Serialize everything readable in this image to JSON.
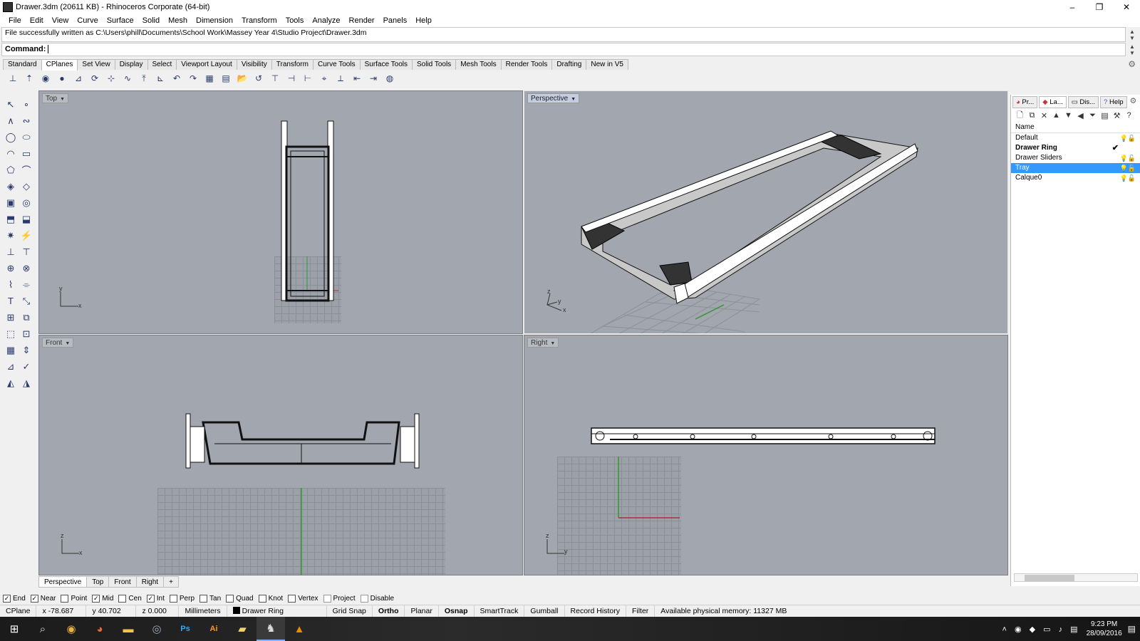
{
  "window": {
    "title": "Drawer.3dm (20611 KB) - Rhinoceros Corporate (64-bit)",
    "buttons": [
      "–",
      "❐",
      "✕"
    ]
  },
  "menu": [
    "File",
    "Edit",
    "View",
    "Curve",
    "Surface",
    "Solid",
    "Mesh",
    "Dimension",
    "Transform",
    "Tools",
    "Analyze",
    "Render",
    "Panels",
    "Help"
  ],
  "command": {
    "history": "File successfully written as C:\\Users\\phill\\Documents\\School Work\\Massey Year 4\\Studio Project\\Drawer.3dm",
    "label": "Command:",
    "value": ""
  },
  "toolbar_tabs": [
    "Standard",
    "CPlanes",
    "Set View",
    "Display",
    "Select",
    "Viewport Layout",
    "Visibility",
    "Transform",
    "Curve Tools",
    "Surface Tools",
    "Solid Tools",
    "Mesh Tools",
    "Render Tools",
    "Drafting",
    "New in V5"
  ],
  "toolbar_active_tab": "CPlanes",
  "viewports": {
    "top": {
      "label": "Top",
      "axis_a": "y",
      "axis_b": "x"
    },
    "perspective": {
      "label": "Perspective",
      "axis_a": "z",
      "axis_b": "y",
      "axis_c": "x"
    },
    "front": {
      "label": "Front",
      "axis_a": "z",
      "axis_b": "x"
    },
    "right": {
      "label": "Right",
      "axis_a": "z",
      "axis_b": "y"
    }
  },
  "view_tabs": [
    "Perspective",
    "Top",
    "Front",
    "Right",
    "+"
  ],
  "osnaps": [
    {
      "label": "End",
      "checked": true
    },
    {
      "label": "Near",
      "checked": true
    },
    {
      "label": "Point",
      "checked": false
    },
    {
      "label": "Mid",
      "checked": true
    },
    {
      "label": "Cen",
      "checked": false
    },
    {
      "label": "Int",
      "checked": true
    },
    {
      "label": "Perp",
      "checked": false
    },
    {
      "label": "Tan",
      "checked": false
    },
    {
      "label": "Quad",
      "checked": false
    },
    {
      "label": "Knot",
      "checked": false
    },
    {
      "label": "Vertex",
      "checked": false
    },
    {
      "label": "Project",
      "checked": false
    },
    {
      "label": "Disable",
      "checked": false
    }
  ],
  "status": {
    "cplane": "CPlane",
    "x": "x -78.687",
    "y": "y 40.702",
    "z": "z 0.000",
    "units": "Millimeters",
    "layer": "Drawer Ring",
    "grid_snap": "Grid Snap",
    "ortho": "Ortho",
    "planar": "Planar",
    "osnap": "Osnap",
    "smarttrack": "SmartTrack",
    "gumball": "Gumball",
    "record_history": "Record History",
    "filter": "Filter",
    "memory": "Available physical memory: 11327 MB"
  },
  "panel": {
    "tabs": [
      "Pr...",
      "La...",
      "Dis...",
      "Help"
    ],
    "header": "Name",
    "layers": [
      {
        "name": "Default",
        "bold": false,
        "selected": false,
        "current": false
      },
      {
        "name": "Drawer Ring",
        "bold": true,
        "selected": false,
        "current": true
      },
      {
        "name": "Drawer Sliders",
        "bold": false,
        "selected": false,
        "current": false
      },
      {
        "name": "Tray",
        "bold": false,
        "selected": true,
        "current": false
      },
      {
        "name": "Calque0",
        "bold": false,
        "selected": false,
        "current": false
      }
    ]
  },
  "taskbar": {
    "time": "9:23 PM",
    "date": "28/09/2016"
  },
  "colors": {
    "viewport_bg": "#a2a6ae",
    "selection": "#3399ff",
    "x_axis": "#b03030",
    "y_axis": "#2f9a2f"
  }
}
